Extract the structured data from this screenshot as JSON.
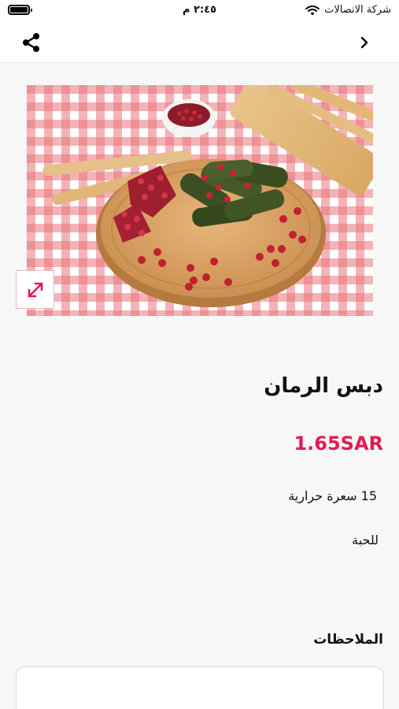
{
  "status_bar": {
    "time": "٢:٤٥ م",
    "carrier": "شركة الاتصالات"
  },
  "nav": {
    "share_icon": "share-icon",
    "back_icon": "chevron-right-icon"
  },
  "product": {
    "image_alt": "stuffed-grape-leaves-with-pomegranate",
    "expand_icon": "expand-icon",
    "title": "دبس الرمان",
    "price": "1.65SAR",
    "calories": "15 سعرة حرارية",
    "unit": "للحبة"
  },
  "notes": {
    "label": "الملاحظات",
    "value": "",
    "placeholder": ""
  },
  "colors": {
    "accent": "#e31b54",
    "background": "#f7f7f7"
  }
}
